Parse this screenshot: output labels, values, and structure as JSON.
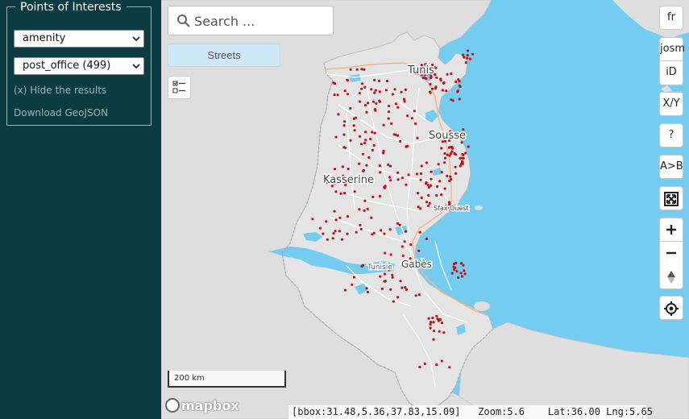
{
  "sidebar": {
    "poi_title": "Points of Interests",
    "category_select": "amenity",
    "type_select": "post_office (499)",
    "hide_results": "(x) Hide the results",
    "download": "Download GeoJSON"
  },
  "search": {
    "placeholder": "Search ..."
  },
  "basemap_button": "Streets",
  "controls": {
    "lang": "fr",
    "josm": "josm",
    "id_editor": "iD",
    "xy": "X/Y",
    "help": "?",
    "ab": "A>B"
  },
  "map": {
    "labels": {
      "tunis": "Tunis",
      "sousse": "Sousse",
      "kasserine": "Kasserine",
      "sfax": "Sfax Ouest",
      "gabes": "Gabès",
      "tunisie": "Tunisie"
    },
    "scale": "200 km",
    "attribution": "mapbox",
    "marker_color": "#c0141a",
    "water_color": "#74cdf0",
    "land_color": "#dedede"
  },
  "status": {
    "bbox": "[bbox:31.48,5.36,37.83,15.09]",
    "zoom": "Zoom:5.6",
    "latlng": "Lat:36.00 Lng:5.65"
  }
}
